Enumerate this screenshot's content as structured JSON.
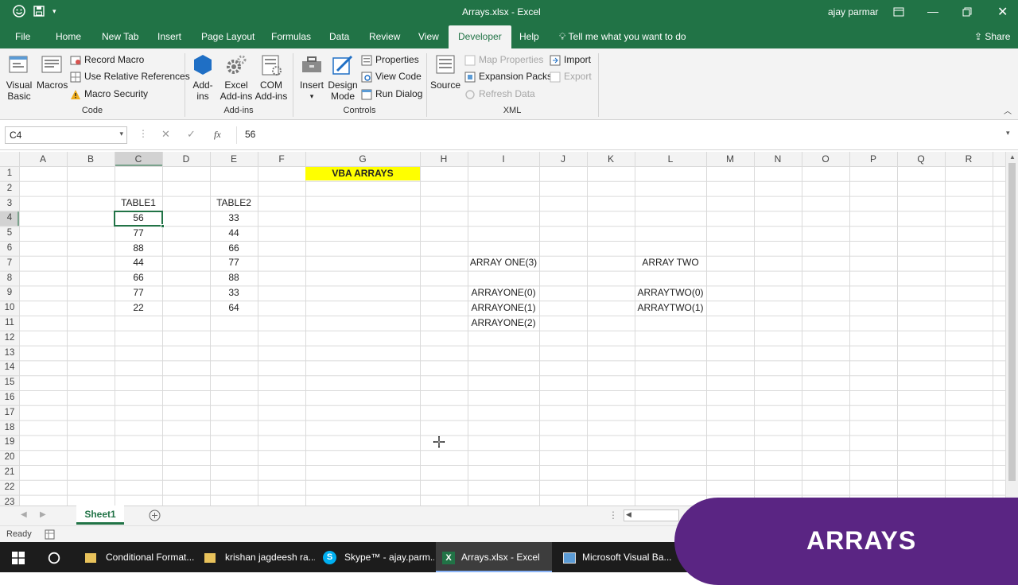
{
  "titlebar": {
    "title": "Arrays.xlsx - Excel",
    "user": "ajay parmar"
  },
  "tabs": [
    "File",
    "Home",
    "New Tab",
    "Insert",
    "Page Layout",
    "Formulas",
    "Data",
    "Review",
    "View",
    "Developer",
    "Help"
  ],
  "tellme": "Tell me what you want to do",
  "share": "Share",
  "ribbon": {
    "code": {
      "visual_basic": "Visual Basic",
      "macros": "Macros",
      "record_macro": "Record Macro",
      "relative": "Use Relative References",
      "security": "Macro Security",
      "label": "Code"
    },
    "addins": {
      "addins": "Add-ins",
      "excel_addins": "Excel Add-ins",
      "com_addins": "COM Add-ins",
      "label": "Add-ins"
    },
    "controls": {
      "insert": "Insert",
      "design_mode": "Design Mode",
      "properties": "Properties",
      "view_code": "View Code",
      "run_dialog": "Run Dialog",
      "label": "Controls"
    },
    "xml": {
      "source": "Source",
      "map_properties": "Map Properties",
      "expansion_packs": "Expansion Packs",
      "refresh_data": "Refresh Data",
      "import": "Import",
      "export": "Export",
      "label": "XML"
    }
  },
  "formula_bar": {
    "name_box": "C4",
    "fx": "fx",
    "value": "56"
  },
  "grid": {
    "columns": [
      "A",
      "B",
      "C",
      "D",
      "E",
      "F",
      "G",
      "H",
      "I",
      "J",
      "K",
      "L",
      "M",
      "N",
      "O",
      "P",
      "Q",
      "R"
    ],
    "rows": [
      "1",
      "2",
      "3",
      "4",
      "5",
      "6",
      "7",
      "8",
      "9",
      "10",
      "11",
      "12",
      "13",
      "14",
      "15",
      "16",
      "17",
      "18",
      "19",
      "20",
      "21",
      "22",
      "23"
    ],
    "cells": {
      "G1": "VBA ARRAYS",
      "C3": "TABLE1",
      "E3": "TABLE2",
      "C4": "56",
      "E4": "33",
      "C5": "77",
      "E5": "44",
      "C6": "88",
      "E6": "66",
      "C7": "44",
      "E7": "77",
      "I7": "ARRAY ONE(3)",
      "L7": "ARRAY TWO",
      "C8": "66",
      "E8": "88",
      "C9": "77",
      "E9": "33",
      "I9": "ARRAYONE(0)",
      "L9": "ARRAYTWO(0)",
      "C10": "22",
      "E10": "64",
      "I10": "ARRAYONE(1)",
      "L10": "ARRAYTWO(1)",
      "I11": "ARRAYONE(2)"
    },
    "selected": "C4",
    "highlight_color": "#ffff00"
  },
  "sheet_tab": "Sheet1",
  "status": "Ready",
  "taskbar": [
    "Conditional Format...",
    "krishan jagdeesh ra...",
    "Skype™ - ajay.parm...",
    "Arrays.xlsx - Excel",
    "Microsoft Visual Ba..."
  ],
  "overlay": "ARRAYS",
  "colors": {
    "excel_green": "#217346",
    "overlay_purple": "#5a2583"
  }
}
